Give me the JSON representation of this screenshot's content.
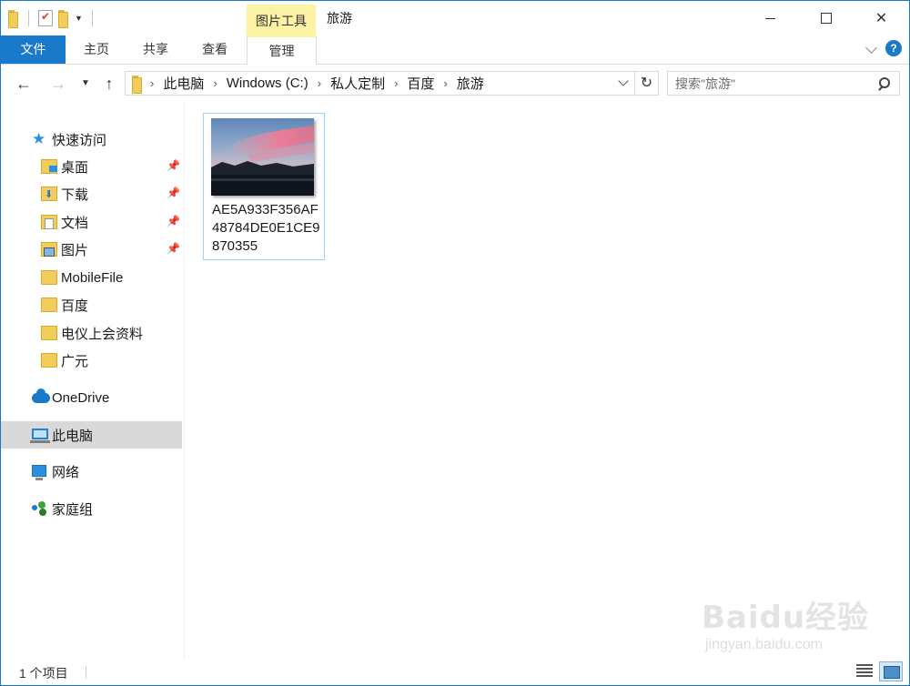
{
  "window": {
    "title": "旅游",
    "context_tab_group": "图片工具",
    "accent_color": "#1979ca",
    "context_color": "#fdf1a4"
  },
  "ribbon": {
    "tabs": [
      {
        "label": "文件"
      },
      {
        "label": "主页"
      },
      {
        "label": "共享"
      },
      {
        "label": "查看"
      },
      {
        "label": "管理"
      }
    ],
    "help_label": "?"
  },
  "address": {
    "crumbs": [
      "此电脑",
      "Windows (C:)",
      "私人定制",
      "百度",
      "旅游"
    ]
  },
  "search": {
    "placeholder": "搜索\"旅游\""
  },
  "sidebar": {
    "quick_access": "快速访问",
    "pinned": [
      {
        "label": "桌面",
        "icon": "desktop-folder-icon"
      },
      {
        "label": "下载",
        "icon": "downloads-folder-icon"
      },
      {
        "label": "文档",
        "icon": "documents-folder-icon"
      },
      {
        "label": "图片",
        "icon": "pictures-folder-icon"
      }
    ],
    "folders": [
      {
        "label": "MobileFile"
      },
      {
        "label": "百度"
      },
      {
        "label": "电仪上会资料"
      },
      {
        "label": "广元"
      }
    ],
    "onedrive": "OneDrive",
    "this_pc": "此电脑",
    "network": "网络",
    "homegroup": "家庭组"
  },
  "content": {
    "files": [
      {
        "name": "AE5A933F356AF48784DE0E1CE9870355",
        "type": "image-thumbnail"
      }
    ]
  },
  "status": {
    "item_count": "1 个项目"
  },
  "watermark": {
    "brand": "Baidu经验",
    "url": "jingyan.baidu.com"
  }
}
